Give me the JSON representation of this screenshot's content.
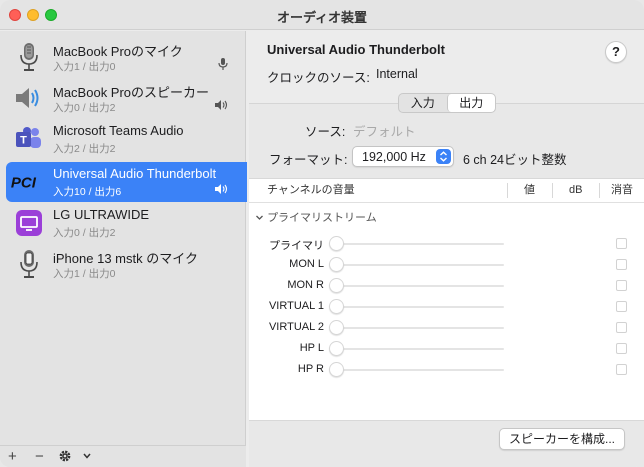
{
  "window": {
    "title": "オーディオ装置"
  },
  "devices": [
    {
      "name": "MacBook Proのマイク",
      "io": "入力1 / 出力0",
      "icon": "microphone-icon",
      "badge": "microphone-badge-icon",
      "selected": false
    },
    {
      "name": "MacBook Proのスピーカー",
      "io": "入力0 / 出力2",
      "icon": "speaker-icon",
      "badge": "speaker-badge-icon",
      "selected": false
    },
    {
      "name": "Microsoft Teams Audio",
      "io": "入力2 / 出力2",
      "icon": "teams-icon",
      "badge": "",
      "selected": false
    },
    {
      "name": "Universal Audio Thunderbolt",
      "io": "入力10 / 出力6",
      "icon": "pci-icon",
      "badge": "speaker-badge-icon",
      "selected": true
    },
    {
      "name": "LG ULTRAWIDE",
      "io": "入力0 / 出力2",
      "icon": "display-icon",
      "badge": "",
      "selected": false
    },
    {
      "name": "iPhone 13 mstk のマイク",
      "io": "入力1 / 出力0",
      "icon": "iphone-microphone-icon",
      "badge": "",
      "selected": false
    }
  ],
  "sidebar_footer": {
    "add": "+",
    "remove": "−",
    "gear": "gear-icon",
    "chevron": "chevron-down-icon"
  },
  "detail": {
    "device_title": "Universal Audio Thunderbolt",
    "help": "?",
    "clock_label": "クロックのソース:",
    "clock_value": "Internal",
    "tabs": [
      {
        "label": "入力",
        "active": false
      },
      {
        "label": "出力",
        "active": true
      }
    ],
    "source_label": "ソース:",
    "source_value": "デフォルト",
    "format_label": "フォーマット:",
    "format_value": "192,000 Hz",
    "format_extra": "6 ch 24ビット整数",
    "table_headers": {
      "channel": "チャンネルの音量",
      "value": "値",
      "db": "dB",
      "mute": "消音"
    },
    "group_label": "プライマリストリーム",
    "channels": [
      "プライマリ",
      "MON L",
      "MON R",
      "VIRTUAL 1",
      "VIRTUAL 2",
      "HP L",
      "HP R"
    ],
    "configure_button": "スピーカーを構成..."
  },
  "colors": {
    "selection": "#3b82f7",
    "accent": "#3b82f7"
  }
}
